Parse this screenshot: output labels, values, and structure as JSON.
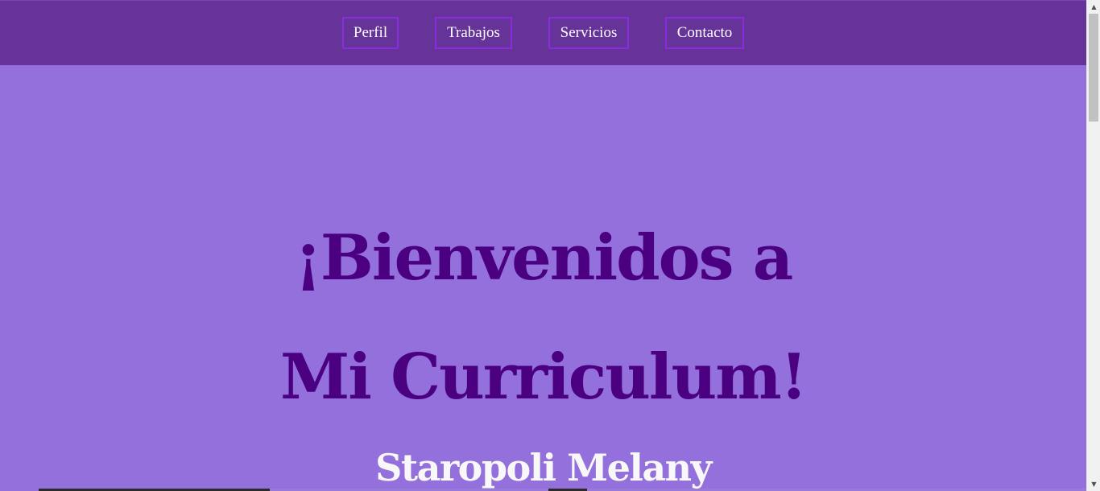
{
  "nav": {
    "items": [
      {
        "label": "Perfil"
      },
      {
        "label": "Trabajos"
      },
      {
        "label": "Servicios"
      },
      {
        "label": "Contacto"
      }
    ]
  },
  "hero": {
    "line1": "¡Bienvenidos a",
    "line2": "Mi Curriculum!",
    "subtitle": "Staropoli Melany"
  },
  "colors": {
    "navbar_bg": "#663399",
    "page_bg": "#9370DB",
    "button_border": "#8A2BE2",
    "heading": "#4B0082",
    "subtitle": "#F8F8F8"
  },
  "scrollbar": {
    "up_icon": "chevron-up-icon",
    "down_icon": "chevron-down-icon"
  }
}
